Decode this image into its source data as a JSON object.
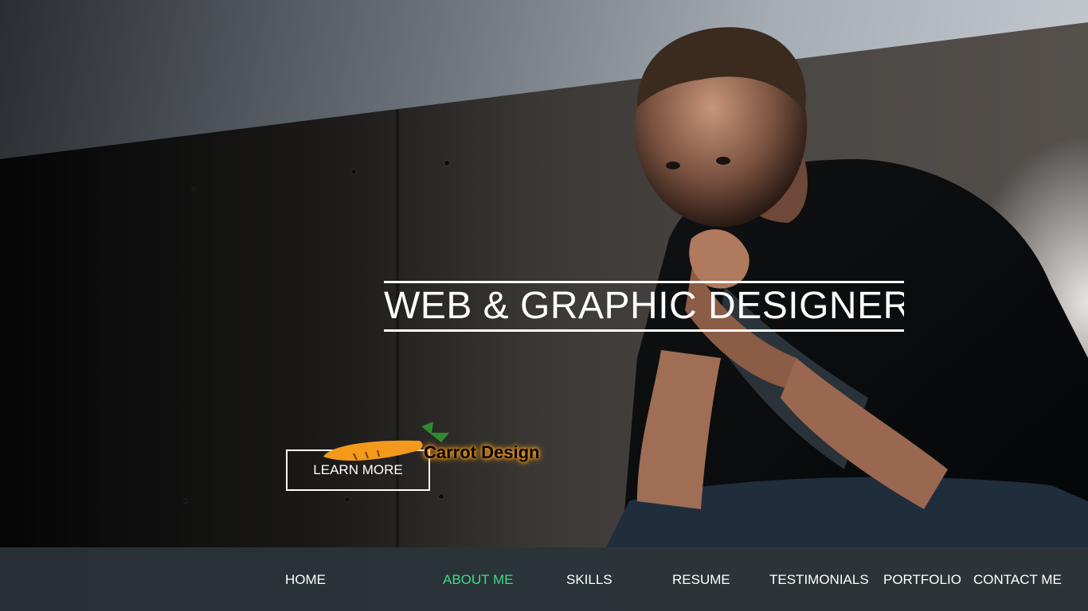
{
  "hero": {
    "headline": "WEB & GRAPHIC DESIGNER",
    "cta_label": "LEARN MORE",
    "logo_text": "Carrot Design"
  },
  "nav": {
    "items": [
      {
        "label": "HOME",
        "active": false
      },
      {
        "label": "ABOUT ME",
        "active": true
      },
      {
        "label": "SKILLS",
        "active": false
      },
      {
        "label": "RESUME",
        "active": false
      },
      {
        "label": "TESTIMONIALS",
        "active": false
      },
      {
        "label": "PORTFOLIO",
        "active": false
      },
      {
        "label": "CONTACT ME",
        "active": false
      }
    ]
  },
  "colors": {
    "accent": "#3ddc84",
    "navbar": "#2b3438",
    "text": "#ffffff",
    "logo_orange": "#f39a1c",
    "logo_green": "#2f8a2f"
  }
}
